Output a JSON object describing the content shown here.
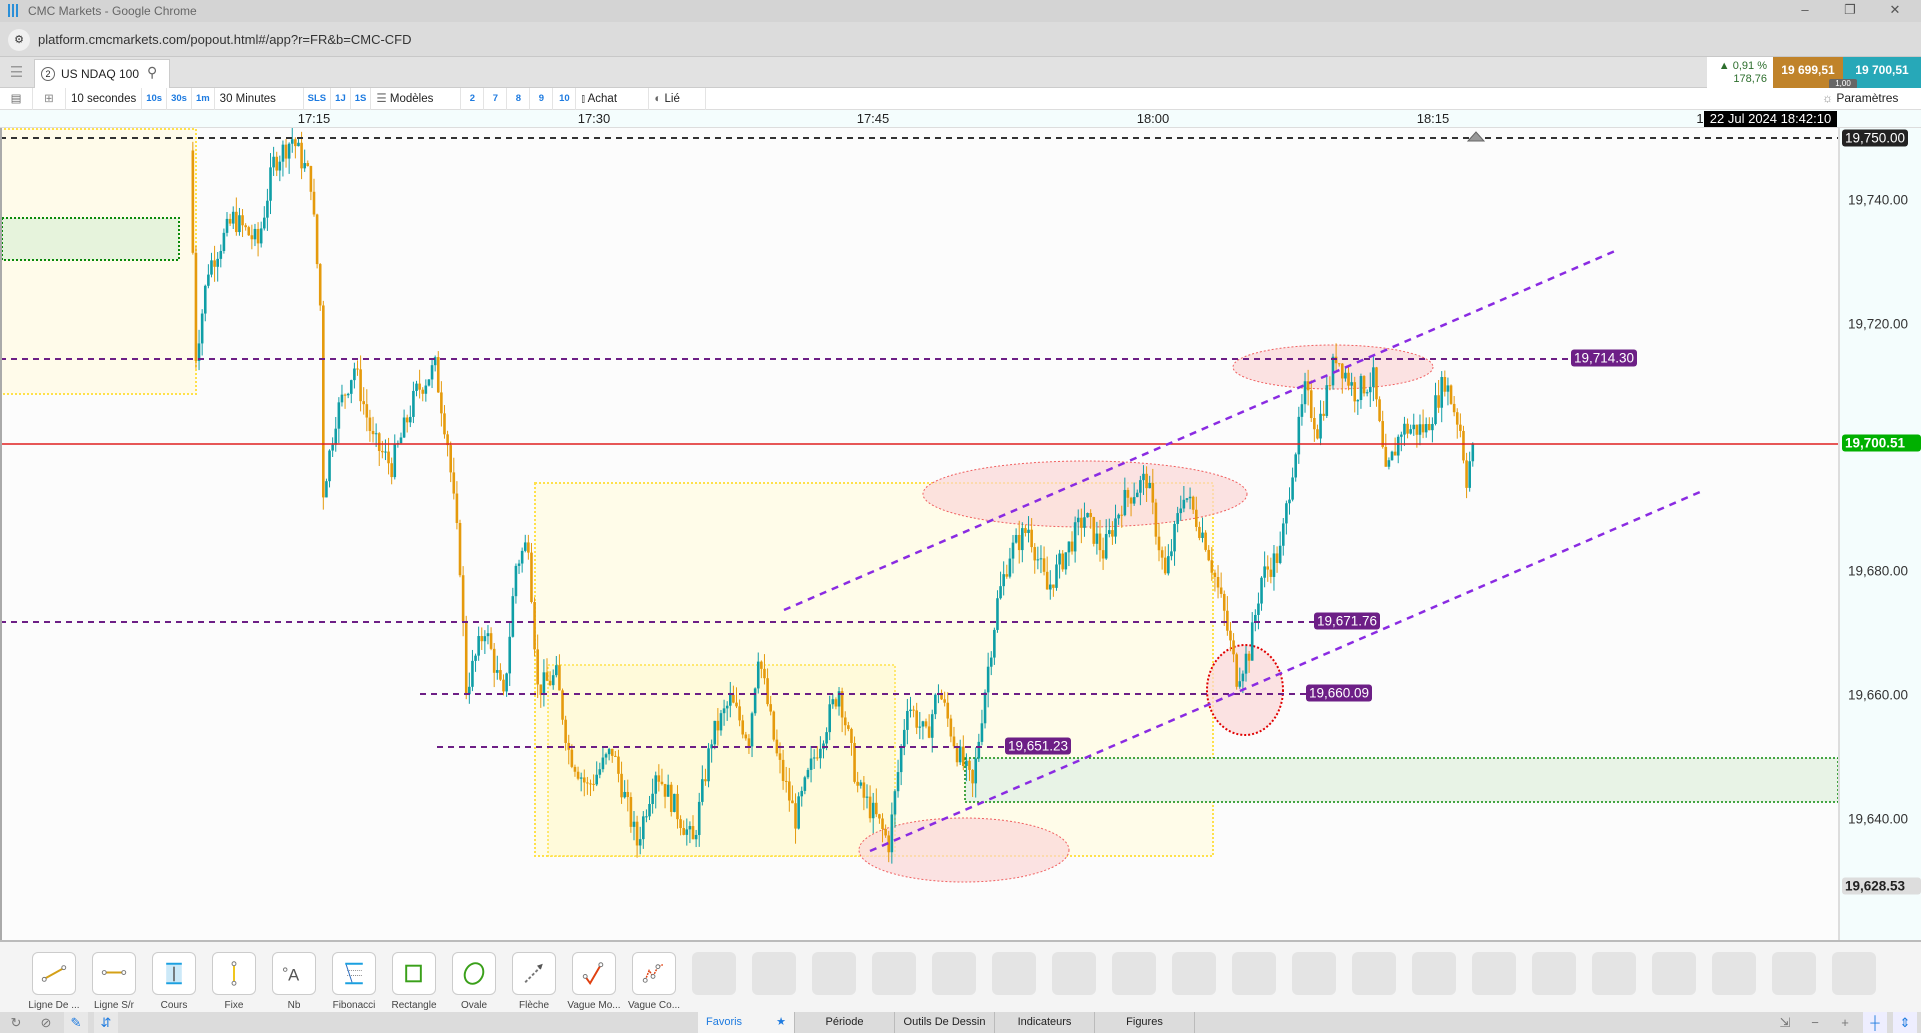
{
  "window": {
    "title": "CMC Markets - Google Chrome",
    "url": "platform.cmcmarkets.com/popout.html#/app?r=FR&b=CMC-CFD"
  },
  "instrument": {
    "tab_number": "2",
    "name": "US NDAQ 100",
    "change_pct": "0,91 %",
    "change_abs": "178,76",
    "sell": "19 699,51",
    "buy": "19 700,51",
    "spread": "1,00"
  },
  "toolbar": {
    "interval": "10 secondes",
    "quick": [
      "10s",
      "30s",
      "1m"
    ],
    "range": "30 Minutes",
    "ranges": [
      "SLS",
      "1J",
      "1S"
    ],
    "models": "Modèles",
    "counts": [
      "2",
      "7",
      "8",
      "9",
      "10"
    ],
    "buy_type": "Achat",
    "linked": "Lié",
    "settings": "Paramètres"
  },
  "time_axis": {
    "labels": [
      "17:15",
      "17:30",
      "17:45",
      "18:00",
      "18:15",
      "1"
    ],
    "cursor_date": "22 Jul 2024 18:42:10"
  },
  "price_axis": {
    "labels": [
      "19,740.00",
      "19,720.00",
      "19,680.00",
      "19,660.00",
      "19,640.00"
    ],
    "top_line": "19,750.00",
    "current": "19,700.51",
    "low": "19,628.53"
  },
  "drawings": {
    "levels": [
      "19,714.30",
      "19,671.76",
      "19,660.09",
      "19,651.23"
    ]
  },
  "colors": {
    "up": "#0f9ea6",
    "down": "#e59a0c",
    "current": "#e02020",
    "level": "#6d1f86",
    "trend": "#8a2be2",
    "sell": "#c0832a",
    "buy": "#27a8b8",
    "current_bg": "#00b000"
  },
  "chart_data": {
    "type": "candlestick",
    "interval": "10 secondes",
    "y_ticks": [
      19740,
      19720,
      19680,
      19660,
      19640
    ],
    "x_ticks": [
      "17:15",
      "17:30",
      "17:45",
      "18:00",
      "18:15"
    ],
    "horizontal_lines": [
      19750.0,
      19714.3,
      19700.51,
      19671.76,
      19660.09,
      19651.23
    ],
    "last_price": 19700.51,
    "approx_close_path": [
      [
        "17:08:20",
        19748
      ],
      [
        "17:08:40",
        19715
      ],
      [
        "17:09:20",
        19729
      ],
      [
        "17:10:40",
        19737
      ],
      [
        "17:12:00",
        19733
      ],
      [
        "17:12:50",
        19746
      ],
      [
        "17:13:50",
        19750
      ],
      [
        "17:14:50",
        19743
      ],
      [
        "17:15:20",
        19723
      ],
      [
        "17:15:30",
        19693
      ],
      [
        "17:16:10",
        19705
      ],
      [
        "17:17:10",
        19713
      ],
      [
        "17:18:10",
        19701
      ],
      [
        "17:19:10",
        19697
      ],
      [
        "17:20:30",
        19709
      ],
      [
        "17:21:30",
        19713
      ],
      [
        "17:22:10",
        19701
      ],
      [
        "17:22:50",
        19681
      ],
      [
        "17:23:10",
        19661
      ],
      [
        "17:24:10",
        19671
      ],
      [
        "17:25:10",
        19659
      ],
      [
        "17:25:50",
        19681
      ],
      [
        "17:26:30",
        19685
      ],
      [
        "17:27:00",
        19661
      ],
      [
        "17:28:00",
        19663
      ],
      [
        "17:28:40",
        19651
      ],
      [
        "17:29:40",
        19645
      ],
      [
        "17:31:00",
        19651
      ],
      [
        "17:32:20",
        19636
      ],
      [
        "17:33:20",
        19648
      ],
      [
        "17:34:20",
        19642
      ],
      [
        "17:35:20",
        19636
      ],
      [
        "17:36:20",
        19653
      ],
      [
        "17:37:20",
        19659
      ],
      [
        "17:38:20",
        19653
      ],
      [
        "17:38:50",
        19667
      ],
      [
        "17:39:50",
        19650
      ],
      [
        "17:40:50",
        19640
      ],
      [
        "17:41:50",
        19650
      ],
      [
        "17:43:10",
        19661
      ],
      [
        "17:44:10",
        19645
      ],
      [
        "17:45:10",
        19640
      ],
      [
        "17:45:50",
        19636
      ],
      [
        "17:46:50",
        19659
      ],
      [
        "17:47:50",
        19653
      ],
      [
        "17:48:30",
        19661
      ],
      [
        "17:49:30",
        19651
      ],
      [
        "17:50:20",
        19645
      ],
      [
        "17:51:00",
        19661
      ],
      [
        "17:51:40",
        19675
      ],
      [
        "17:52:20",
        19683
      ],
      [
        "17:53:20",
        19687
      ],
      [
        "17:54:20",
        19677
      ],
      [
        "17:55:20",
        19683
      ],
      [
        "17:56:20",
        19689
      ],
      [
        "17:57:20",
        19683
      ],
      [
        "17:58:20",
        19691
      ],
      [
        "17:59:40",
        19695
      ],
      [
        "18:00:40",
        19679
      ],
      [
        "18:01:40",
        19693
      ],
      [
        "18:02:50",
        19685
      ],
      [
        "18:03:50",
        19673
      ],
      [
        "18:04:30",
        19663
      ],
      [
        "18:05:10",
        19667
      ],
      [
        "18:05:50",
        19679
      ],
      [
        "18:06:50",
        19683
      ],
      [
        "18:07:30",
        19697
      ],
      [
        "18:08:10",
        19709
      ],
      [
        "18:08:50",
        19703
      ],
      [
        "18:09:50",
        19715
      ],
      [
        "18:10:50",
        19709
      ],
      [
        "18:11:50",
        19711
      ],
      [
        "18:12:30",
        19695
      ],
      [
        "18:13:20",
        19703
      ],
      [
        "18:14:40",
        19703
      ],
      [
        "18:15:40",
        19711
      ],
      [
        "18:16:30",
        19703
      ],
      [
        "18:16:50",
        19695
      ],
      [
        "18:17:10",
        19700.51
      ]
    ]
  },
  "tools": [
    {
      "label": "Ligne De ...",
      "icon": "trend-line"
    },
    {
      "label": "Ligne S/r",
      "icon": "sr-line"
    },
    {
      "label": "Cours",
      "icon": "price-range"
    },
    {
      "label": "Fixe",
      "icon": "vertical-line"
    },
    {
      "label": "Nb",
      "icon": "text"
    },
    {
      "label": "Fibonacci",
      "icon": "fibonacci"
    },
    {
      "label": "Rectangle",
      "icon": "rectangle"
    },
    {
      "label": "Ovale",
      "icon": "oval"
    },
    {
      "label": "Flèche",
      "icon": "arrow"
    },
    {
      "label": "Vague Mo...",
      "icon": "wave"
    },
    {
      "label": "Vague Co...",
      "icon": "wave-complex"
    }
  ],
  "bottom_tabs": [
    "Favoris",
    "Période",
    "Outils De Dessin",
    "Indicateurs",
    "Figures"
  ]
}
